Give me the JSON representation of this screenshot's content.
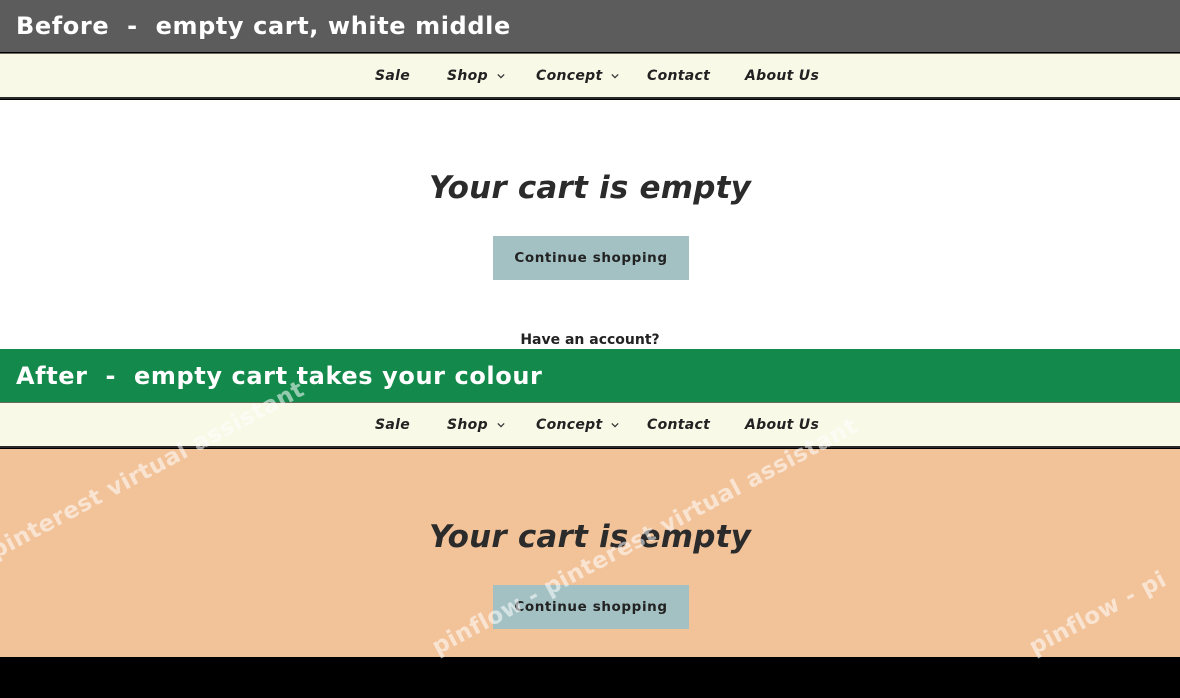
{
  "banners": {
    "before": "Before  -  empty cart, white middle",
    "after": "After  -  empty cart takes your colour"
  },
  "nav": {
    "items": [
      "Sale",
      "Shop",
      "Concept",
      "Contact",
      "About Us"
    ]
  },
  "cart": {
    "title": "Your cart is empty",
    "continue_label": "Continue shopping",
    "account_prompt": "Have an account?"
  },
  "watermark": {
    "text1": "pinterest virtual assistant",
    "text2": "pinflow  -  pinterest virtual assistant",
    "text3": "pinflow  -  pi"
  },
  "colors": {
    "before_banner": "#5c5c5c",
    "after_banner": "#138a4b",
    "nav_bg": "#f9f9e8",
    "after_panel_bg": "#f2c299",
    "button_bg": "#a3c1c3"
  }
}
